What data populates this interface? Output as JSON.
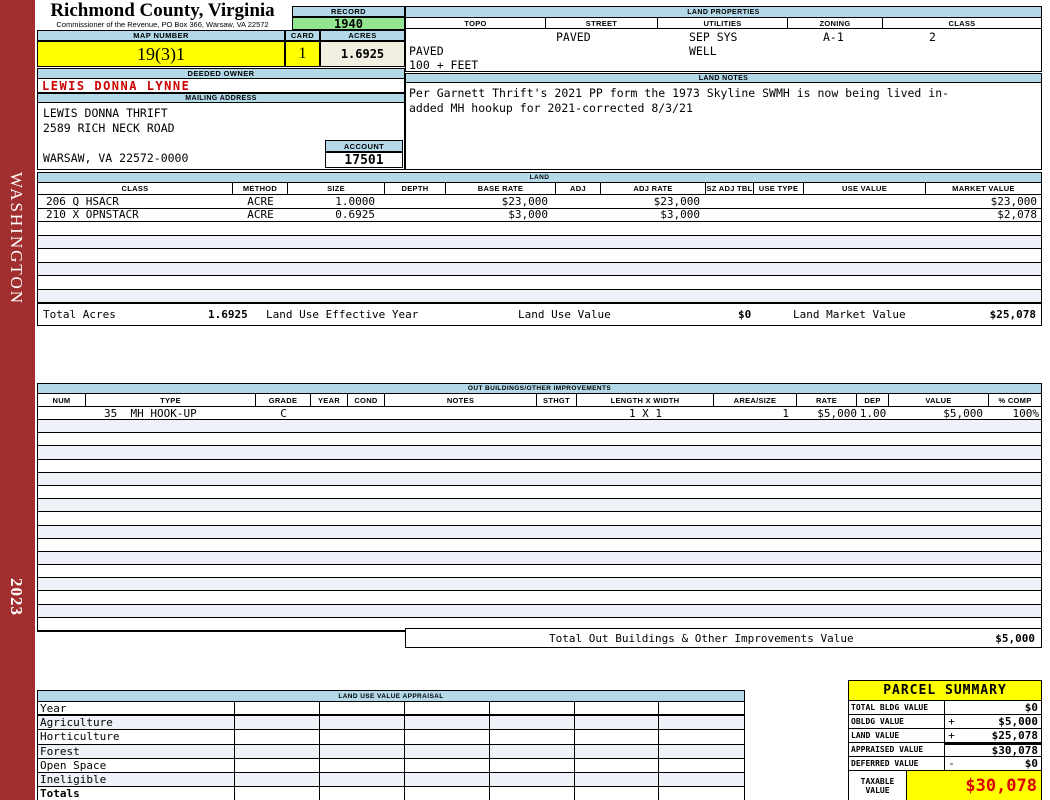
{
  "header": {
    "county_title": "Richmond County, Virginia",
    "commissioner_line": "Commissioner of the Revenue, PO Box 366, Warsaw, VA 22572",
    "record_label": "RECORD",
    "record_value": "1940",
    "map_number_label": "MAP NUMBER",
    "map_number": "19(3)1",
    "card_label": "CARD",
    "card": "1",
    "acres_label": "ACRES",
    "acres": "1.6925"
  },
  "sidebar": {
    "district": "WASHINGTON",
    "year": "2023"
  },
  "land_properties": {
    "title": "LAND PROPERTIES",
    "columns": [
      "TOPO",
      "STREET",
      "UTILITIES",
      "ZONING",
      "CLASS"
    ],
    "street": "PAVED",
    "utilities1": "SEP SYS",
    "zoning": "A-1",
    "class": "2",
    "topo1": "PAVED",
    "utilities2": "WELL",
    "topo2": "100 + FEET"
  },
  "owner": {
    "deeded_owner_label": "DEEDED OWNER",
    "deeded_owner": "LEWIS DONNA LYNNE",
    "mailing_address_label": "MAILING ADDRESS",
    "mailing_line1": "LEWIS DONNA THRIFT",
    "mailing_line2": "2589 RICH NECK ROAD",
    "mailing_line3": "WARSAW, VA 22572-0000",
    "account_label": "ACCOUNT",
    "account": "17501"
  },
  "land_notes": {
    "title": "LAND NOTES",
    "line1": "Per Garnett Thrift's 2021 PP form the 1973 Skyline SWMH is now being lived in-",
    "line2": "added MH hookup for 2021-corrected 8/3/21"
  },
  "land": {
    "title": "LAND",
    "columns": [
      "CLASS",
      "METHOD",
      "SIZE",
      "DEPTH",
      "BASE RATE",
      "ADJ",
      "ADJ RATE",
      "SZ ADJ TBL",
      "USE TYPE",
      "USE VALUE",
      "MARKET VALUE"
    ],
    "rows": [
      {
        "class": "206 Q HSACR",
        "method": "ACRE",
        "size": "1.0000",
        "base_rate": "$23,000",
        "adj_rate": "$23,000",
        "market_value": "$23,000"
      },
      {
        "class": "210 X OPNSTACR",
        "method": "ACRE",
        "size": "0.6925",
        "base_rate": "$3,000",
        "adj_rate": "$3,000",
        "market_value": "$2,078"
      }
    ],
    "totals": {
      "total_acres_label": "Total Acres",
      "total_acres": "1.6925",
      "effective_year_label": "Land Use Effective Year",
      "use_value_label": "Land Use Value",
      "use_value": "$0",
      "market_value_label": "Land Market Value",
      "market_value": "$25,078"
    }
  },
  "out_buildings": {
    "title": "OUT BUILDINGS/OTHER IMPROVEMENTS",
    "columns": [
      "NUM",
      "TYPE",
      "GRADE",
      "YEAR",
      "COND",
      "NOTES",
      "STHGT",
      "LENGTH X WIDTH",
      "AREA/SIZE",
      "RATE",
      "DEP",
      "VALUE",
      "% COMP"
    ],
    "rows": [
      {
        "type": "35  MH HOOK-UP",
        "grade": "C",
        "lxw": "1 X 1",
        "area": "1",
        "rate": "$5,000",
        "dep": "1.00",
        "value": "$5,000",
        "comp": "100%"
      }
    ],
    "total_label": "Total Out Buildings & Other Improvements Value",
    "total_value": "$5,000"
  },
  "land_use_appraisal": {
    "title": "LAND USE VALUE APPRAISAL",
    "row_labels": [
      "Year",
      "Agriculture",
      "Horticulture",
      "Forest",
      "Open Space",
      "Ineligible",
      "Totals"
    ]
  },
  "parcel_summary": {
    "title": "PARCEL SUMMARY",
    "rows": [
      {
        "label": "TOTAL BLDG VALUE",
        "op": "",
        "value": "$0"
      },
      {
        "label": "OBLDG VALUE",
        "op": "+",
        "value": "$5,000"
      },
      {
        "label": "LAND VALUE",
        "op": "+",
        "value": "$25,078"
      },
      {
        "label": "APPRAISED VALUE",
        "op": "",
        "value": "$30,078"
      },
      {
        "label": "DEFERRED VALUE",
        "op": "-",
        "value": "$0"
      }
    ],
    "taxable_label_line1": "TAXABLE",
    "taxable_label_line2": "VALUE",
    "taxable_value": "$30,078"
  },
  "colors": {
    "header_blue": "#b3d9e8",
    "record_green": "#92e692",
    "highlight_yellow": "#ffff00",
    "acres_cream": "#f0efe0",
    "sidebar_red": "#a22f2f",
    "owner_red": "#cc0000",
    "taxable_red": "#dd0000"
  }
}
